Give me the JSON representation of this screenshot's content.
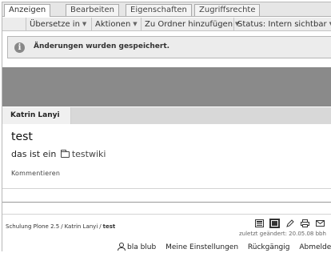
{
  "tabs": [
    {
      "label": "Anzeigen",
      "active": true
    },
    {
      "label": "Bearbeiten",
      "active": false
    },
    {
      "label": "Eigenschaften",
      "active": false
    },
    {
      "label": "Zugriffsrechte",
      "active": false
    }
  ],
  "actions": {
    "translate": "Übersetze in",
    "actions": "Aktionen",
    "add_to_folder": "Zu Ordner hinzufügen",
    "status": "Status: Intern sichtbar"
  },
  "message": {
    "icon": "info-icon",
    "text": "Änderungen wurden gespeichert."
  },
  "portlet": {
    "user_tab": "Katrin Lanyi"
  },
  "document": {
    "title": "test",
    "body_prefix": "das ist ein",
    "folder_icon": "folder-icon",
    "link_text": "testwiki",
    "comments_label": "Kommentieren"
  },
  "breadcrumb": {
    "items": [
      "Schulung Plone 2.5",
      "Katrin Lanyi",
      "test"
    ],
    "separator": "/"
  },
  "document_tools": {
    "icons": [
      "view-icon",
      "view-selected-icon",
      "edit-icon",
      "print-icon",
      "send-icon",
      "rss-icon"
    ],
    "last_modified": "zuletzt geändert: 20.05.08 bbh"
  },
  "personal_bar": {
    "user_icon": "user-icon",
    "user": "bla blub",
    "preferences": "Meine Einstellungen",
    "undo": "Rückgängig",
    "logout": "Abmelden"
  },
  "colors": {
    "banner": "#8a8a8a",
    "page_background": "#ffffff",
    "message_background": "#ececec"
  }
}
